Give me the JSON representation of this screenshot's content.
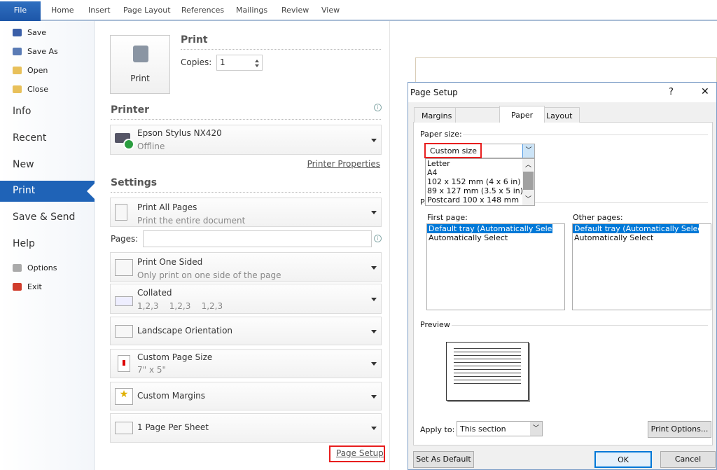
{
  "ribbon": {
    "tabs": [
      "File",
      "Home",
      "Insert",
      "Page Layout",
      "References",
      "Mailings",
      "Review",
      "View"
    ]
  },
  "sidebar": {
    "small_top": [
      {
        "label": "Save",
        "icon": "save-icon"
      },
      {
        "label": "Save As",
        "icon": "save-as-icon"
      },
      {
        "label": "Open",
        "icon": "folder-open-icon"
      },
      {
        "label": "Close",
        "icon": "folder-close-icon"
      }
    ],
    "big": [
      "Info",
      "Recent",
      "New",
      "Print",
      "Save & Send",
      "Help"
    ],
    "small_bottom": [
      {
        "label": "Options",
        "icon": "options-icon"
      },
      {
        "label": "Exit",
        "icon": "exit-icon"
      }
    ],
    "selected": "Print"
  },
  "print": {
    "button": "Print",
    "heading": "Print",
    "copies_label": "Copies:",
    "copies_value": "1"
  },
  "printer": {
    "heading": "Printer",
    "name": "Epson Stylus NX420",
    "status": "Offline",
    "properties_link": "Printer Properties"
  },
  "settings": {
    "heading": "Settings",
    "pages_label": "Pages:",
    "pages_value": "",
    "items": [
      {
        "l1": "Print All Pages",
        "l2": "Print the entire document"
      },
      {
        "l1": "Print One Sided",
        "l2": "Only print on one side of the page"
      },
      {
        "l1": "Collated",
        "l2": "1,2,3    1,2,3    1,2,3"
      },
      {
        "l1": "Landscape Orientation",
        "l2": ""
      },
      {
        "l1": "Custom Page Size",
        "l2": "7\" x 5\""
      },
      {
        "l1": "Custom Margins",
        "l2": ""
      },
      {
        "l1": "1 Page Per Sheet",
        "l2": ""
      }
    ],
    "page_setup_link": "Page Setup"
  },
  "dialog": {
    "title": "Page Setup",
    "help": "?",
    "close": "✕",
    "tabs": [
      "Margins",
      "Paper",
      "Layout"
    ],
    "active_tab": "Paper",
    "paper_size_label": "Paper size:",
    "paper_size_value": "Custom size",
    "paper_options": [
      "Letter",
      "A4",
      "102 x 152 mm (4 x 6 in)",
      "89 x 127 mm (3.5 x 5 in)",
      "Postcard 100 x 148 mm"
    ],
    "paper_source_partial": "Pa",
    "first_page_label": "First page:",
    "other_pages_label": "Other pages:",
    "trays": [
      "Default tray (Automatically Select)",
      "Automatically Select"
    ],
    "preview_label": "Preview",
    "apply_to_label": "Apply to:",
    "apply_to_value": "This section",
    "print_options": "Print Options...",
    "set_default": "Set As Default",
    "ok": "OK",
    "cancel": "Cancel"
  },
  "colors": {
    "accent": "#1f63b7",
    "highlight": "#e81e1e",
    "selection": "#0078d7"
  }
}
